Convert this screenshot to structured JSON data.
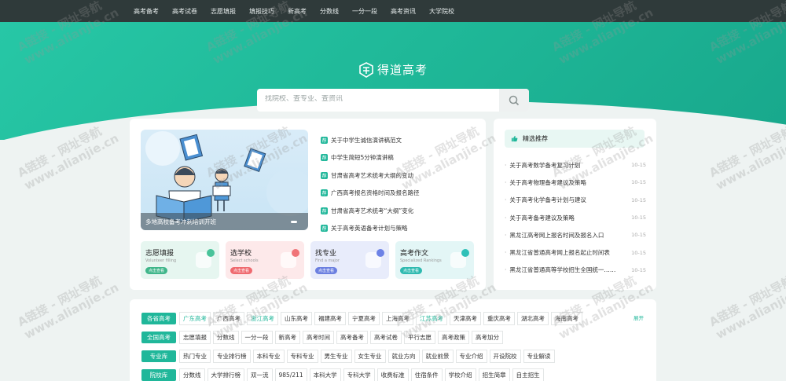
{
  "topnav": [
    "高考备考",
    "高考试卷",
    "志愿填报",
    "填报技巧",
    "新高考",
    "分数线",
    "一分一段",
    "高考资讯",
    "大学院校"
  ],
  "logo": {
    "text": "得道高考"
  },
  "search": {
    "placeholder": "找院校、查专业、查资讯",
    "icon": "search-icon"
  },
  "banner": {
    "caption": "多地高校备考冲刺培训开班"
  },
  "news": [
    "关于中学生诚信演讲稿范文",
    "中学生简短5分钟演讲稿",
    "甘肃省高考艺术统考大纲的变动",
    "广西高考报名资格时间及报名路径",
    "甘肃省高考艺术统考“大纲”变化",
    "关于高考英语备考计划与策略"
  ],
  "tiles": [
    {
      "title": "志愿填报",
      "sub": "Volunteer filling",
      "btn": "点击查看",
      "color": "#e6f6f0",
      "btn_color": "#3fb68a",
      "dot": "#49c39a"
    },
    {
      "title": "选学校",
      "sub": "Select schools",
      "btn": "点击查看",
      "color": "#fde9ea",
      "btn_color": "#ef6a6f",
      "dot": "#f07478"
    },
    {
      "title": "找专业",
      "sub": "Find a major",
      "btn": "点击查看",
      "color": "#e8ecfb",
      "btn_color": "#6b7fe0",
      "dot": "#6d82e6"
    },
    {
      "title": "高考作文",
      "sub": "Specialized Rankings",
      "btn": "点击查看",
      "color": "#e3f6f6",
      "btn_color": "#2fbab0",
      "dot": "#2fc0b8"
    }
  ],
  "recommend": {
    "title": "精选推荐",
    "items": [
      {
        "title": "关于高考数学备考复习计划",
        "date": "10-15"
      },
      {
        "title": "关于高考物理备考建议及策略",
        "date": "10-15"
      },
      {
        "title": "关于高考化学备考计划与建议",
        "date": "10-15"
      },
      {
        "title": "关于高考备考建议及策略",
        "date": "10-15"
      },
      {
        "title": "黑龙江高考网上报名时间及报名入口",
        "date": "10-15"
      },
      {
        "title": "黑龙江省普通高考网上报名起止时间表",
        "date": "10-15"
      },
      {
        "title": "黑龙江省普通高等学校招生全国统一……",
        "date": "10-15"
      }
    ]
  },
  "filters": {
    "expand": "展开",
    "rows": [
      {
        "label": "各省高考",
        "items": [
          "广东高考",
          "广西高考",
          "浙江高考",
          "山东高考",
          "福建高考",
          "宁夏高考",
          "上海高考",
          "江苏高考",
          "天津高考",
          "重庆高考",
          "湖北高考",
          "海南高考"
        ],
        "active": [
          0,
          2,
          7
        ]
      },
      {
        "label": "全国高考",
        "items": [
          "志愿填报",
          "分数线",
          "一分一段",
          "新高考",
          "高考时间",
          "高考备考",
          "高考试卷",
          "平行志愿",
          "高考政策",
          "高考加分"
        ],
        "active": []
      },
      {
        "label": "专业库",
        "items": [
          "热门专业",
          "专业排行榜",
          "本科专业",
          "专科专业",
          "男生专业",
          "女生专业",
          "就业方向",
          "就业前景",
          "专业介绍",
          "开设院校",
          "专业解读"
        ],
        "active": []
      },
      {
        "label": "院校库",
        "items": [
          "分数线",
          "大学排行榜",
          "双一流",
          "985/211",
          "本科大学",
          "专科大学",
          "收费标准",
          "住宿条件",
          "学校介绍",
          "招生简章",
          "自主招生"
        ],
        "active": []
      }
    ]
  },
  "watermark": {
    "line1": "A链接 - 网址导航",
    "line2": "www.alianjie.cn"
  }
}
